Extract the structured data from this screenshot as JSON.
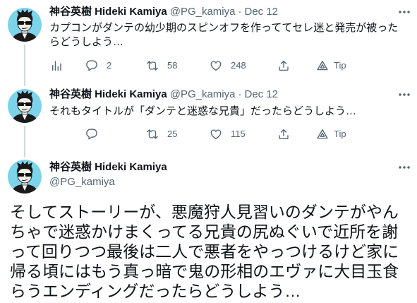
{
  "colors": {
    "text": "#0f1419",
    "secondary": "#536471",
    "thread_line": "#cfd9de",
    "avatar_bg": "#7dd4ea",
    "background": "#ffffff"
  },
  "icons": {
    "analytics": "analytics-icon",
    "reply": "reply-icon",
    "retweet": "retweet-icon",
    "like": "heart-icon",
    "share": "share-icon",
    "tip": "tip-icon",
    "more": "more-icon"
  },
  "tweets": [
    {
      "name": "神谷英樹 Hideki Kamiya",
      "handle": "@PG_kamiya",
      "separator": "·",
      "date": "Dec 12",
      "text": "カプコンがダンテの幼少期のスピンオフを作っててセレ迷と発売が被ったらどうしよう…",
      "replies": "2",
      "retweets": "58",
      "likes": "248",
      "tip_label": "Tip"
    },
    {
      "name": "神谷英樹 Hideki Kamiya",
      "handle": "@PG_kamiya",
      "separator": "·",
      "date": "Dec 12",
      "text": "それもタイトルが「ダンテと迷惑な兄貴」だったらどうしよう…",
      "retweets": "25",
      "likes": "115",
      "tip_label": "Tip"
    }
  ],
  "focal_tweet": {
    "name": "神谷英樹 Hideki Kamiya",
    "handle": "@PG_kamiya",
    "text": "そしてストーリーが、悪魔狩人見習いのダンテがやんちゃで迷惑かけまくってる兄貴の尻ぬぐいで近所を謝って回りつつ最後は二人で悪者をやっつけるけど家に帰る頃にはもう真っ暗で鬼の形相のエヴァに大目玉食らうエンディングだったらどうしよう…"
  }
}
